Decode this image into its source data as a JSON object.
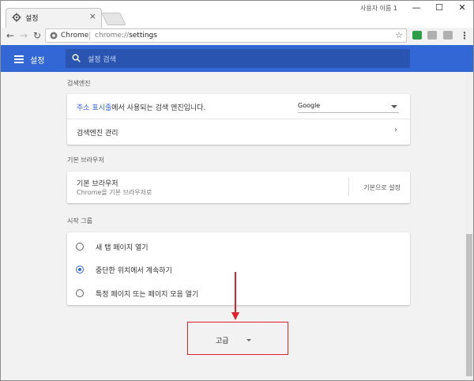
{
  "browser": {
    "tab_title": "설정",
    "tab_close": "×",
    "profile": "사용자 이름 1",
    "window_controls": {
      "minimize": "—",
      "maximize": "☐",
      "close": "✕"
    },
    "nav": {
      "back": "←",
      "forward": "→",
      "reload": "↻"
    },
    "omnibox": {
      "site_chip": "Chrome",
      "url_scheme": "chrome://",
      "url_path": "settings",
      "star": "☆"
    },
    "menu": "⋮"
  },
  "header": {
    "title": "설정",
    "search_placeholder": "설정 검색"
  },
  "sections": {
    "search_engine": {
      "title": "검색엔진",
      "address_bar_link": "주소 표시줄",
      "address_bar_text": "에서 사용되는 검색 엔진입니다.",
      "engine_value": "Google",
      "manage_label": "검색엔진 관리",
      "chevron": "›"
    },
    "default_browser": {
      "title": "기본 브라우저",
      "label": "기본 브라우저",
      "sub": "Chrome을 기본 브라우저로",
      "button": "기본으로 설정"
    },
    "startup": {
      "title": "시작 그룹",
      "options": [
        {
          "label": "새 탭 페이지 열기",
          "selected": false
        },
        {
          "label": "중단한 위치에서 계속하기",
          "selected": true
        },
        {
          "label": "특정 페이지 또는 페이지 모음 열기",
          "selected": false
        }
      ]
    }
  },
  "advanced_label": "고급",
  "colors": {
    "accent": "#3367d6",
    "annotation": "#e0202a"
  }
}
